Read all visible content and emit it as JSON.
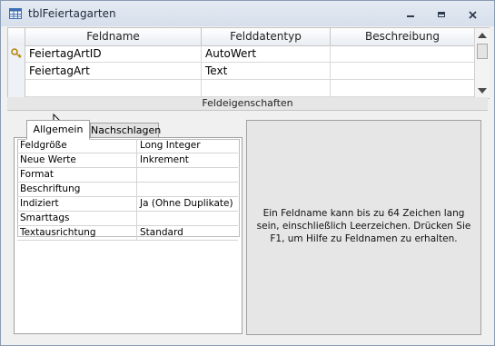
{
  "window": {
    "title": "tblFeiertagarten"
  },
  "grid": {
    "columns": [
      "Feldname",
      "Felddatentyp",
      "Beschreibung"
    ],
    "rows": [
      {
        "name": "FeiertagArtID",
        "type": "AutoWert",
        "description": "",
        "primary_key": true
      },
      {
        "name": "FeiertagArt",
        "type": "Text",
        "description": "",
        "primary_key": false
      },
      {
        "name": "",
        "type": "",
        "description": "",
        "primary_key": false
      }
    ]
  },
  "properties": {
    "section_label": "Feldeigenschaften",
    "tabs": [
      "Allgemein",
      "Nachschlagen"
    ],
    "active_tab": "Allgemein",
    "rows": [
      {
        "label": "Feldgröße",
        "value": "Long Integer"
      },
      {
        "label": "Neue Werte",
        "value": "Inkrement"
      },
      {
        "label": "Format",
        "value": ""
      },
      {
        "label": "Beschriftung",
        "value": ""
      },
      {
        "label": "Indiziert",
        "value": "Ja (Ohne Duplikate)"
      },
      {
        "label": "Smarttags",
        "value": ""
      },
      {
        "label": "Textausrichtung",
        "value": "Standard"
      }
    ]
  },
  "help": {
    "text": "Ein Feldname kann bis zu 64 Zeichen lang sein, einschließlich Leerzeichen. Drücken Sie F1, um Hilfe zu Feldnamen zu erhalten."
  },
  "icons": {
    "table": "table-icon",
    "key": "primary-key-icon",
    "minimize": "minimize-icon",
    "maximize": "maximize-icon",
    "close": "close-icon"
  }
}
